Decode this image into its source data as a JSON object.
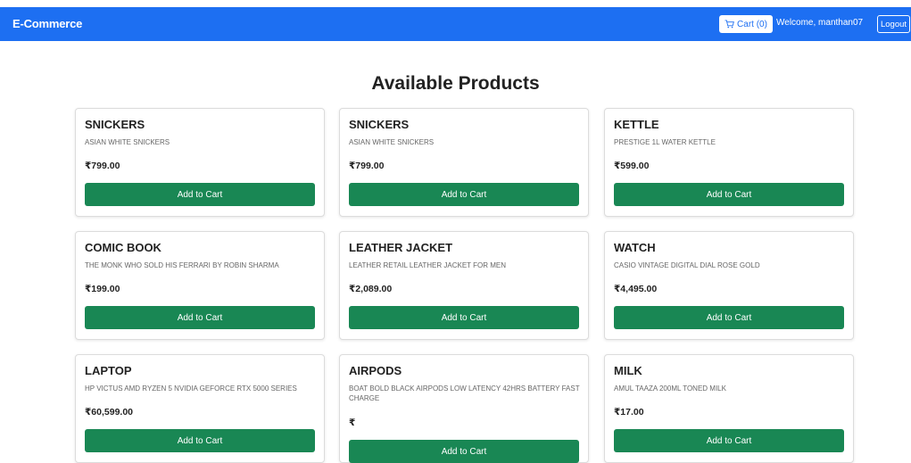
{
  "navbar": {
    "brand": "E-Commerce",
    "cart_label": "Cart (0)",
    "welcome_text": "Welcome, manthan07",
    "logout_label": "Logout"
  },
  "page": {
    "title": "Available Products"
  },
  "products": [
    {
      "name": "SNICKERS",
      "description": "ASIAN WHITE SNICKERS",
      "price": "₹799.00",
      "button": "Add to Cart"
    },
    {
      "name": "SNICKERS",
      "description": "ASIAN WHITE SNICKERS",
      "price": "₹799.00",
      "button": "Add to Cart"
    },
    {
      "name": "KETTLE",
      "description": "PRESTIGE 1L WATER KETTLE",
      "price": "₹599.00",
      "button": "Add to Cart"
    },
    {
      "name": "COMIC BOOK",
      "description": "THE MONK WHO SOLD HIS FERRARI BY ROBIN SHARMA",
      "price": "₹199.00",
      "button": "Add to Cart"
    },
    {
      "name": "LEATHER JACKET",
      "description": "LEATHER RETAIL LEATHER JACKET FOR MEN",
      "price": "₹2,089.00",
      "button": "Add to Cart"
    },
    {
      "name": "WATCH",
      "description": "CASIO VINTAGE DIGITAL DIAL ROSE GOLD",
      "price": "₹4,495.00",
      "button": "Add to Cart"
    },
    {
      "name": "LAPTOP",
      "description": "HP VICTUS AMD RYZEN 5 NVIDIA GEFORCE RTX 5000 SERIES",
      "price": "₹60,599.00",
      "button": "Add to Cart"
    },
    {
      "name": "AIRPODS",
      "description": "BOAT BOLD BLACK AIRPODS LOW LATENCY 42HRS BATTERY FAST CHARGE",
      "price": "₹",
      "button": "Add to Cart"
    },
    {
      "name": "MILK",
      "description": "AMUL TAAZA 200ML TONED MILK",
      "price": "₹17.00",
      "button": "Add to Cart"
    }
  ],
  "colors": {
    "navbar_bg": "#1d6ff2",
    "button_bg": "#198754"
  }
}
